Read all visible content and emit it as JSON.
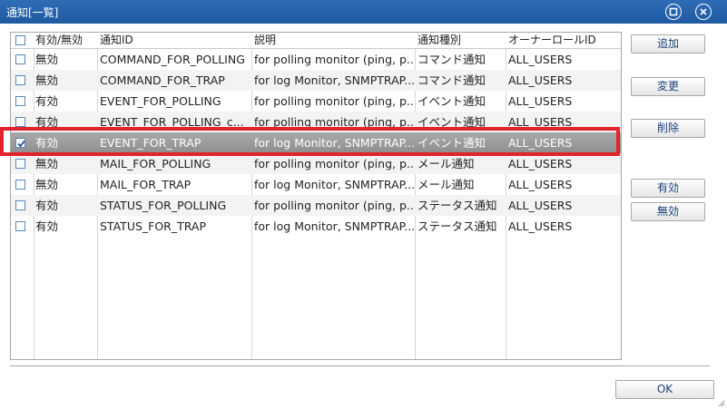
{
  "window": {
    "title": "通知[一覧]"
  },
  "table": {
    "headers": {
      "enabled": "有効/無効",
      "id": "通知ID",
      "desc": "説明",
      "type": "通知種別",
      "owner": "オーナーロールID"
    },
    "rows": [
      {
        "checked": false,
        "enabled": "無効",
        "id": "COMMAND_FOR_POLLING",
        "desc": "for polling monitor (ping, p...",
        "type": "コマンド通知",
        "owner": "ALL_USERS"
      },
      {
        "checked": false,
        "enabled": "無効",
        "id": "COMMAND_FOR_TRAP",
        "desc": "for log Monitor, SNMPTRAP...",
        "type": "コマンド通知",
        "owner": "ALL_USERS"
      },
      {
        "checked": false,
        "enabled": "有効",
        "id": "EVENT_FOR_POLLING",
        "desc": "for polling monitor (ping, p...",
        "type": "イベント通知",
        "owner": "ALL_USERS"
      },
      {
        "checked": false,
        "enabled": "有効",
        "id": "EVENT_FOR_POLLING_c...",
        "desc": "for polling monitor (ping, p...",
        "type": "イベント通知",
        "owner": "ALL_USERS"
      },
      {
        "checked": true,
        "enabled": "有効",
        "id": "EVENT_FOR_TRAP",
        "desc": "for log Monitor, SNMPTRAP...",
        "type": "イベント通知",
        "owner": "ALL_USERS"
      },
      {
        "checked": false,
        "enabled": "無効",
        "id": "MAIL_FOR_POLLING",
        "desc": "for polling monitor (ping, p...",
        "type": "メール通知",
        "owner": "ALL_USERS"
      },
      {
        "checked": false,
        "enabled": "無効",
        "id": "MAIL_FOR_TRAP",
        "desc": "for log Monitor, SNMPTRAP...",
        "type": "メール通知",
        "owner": "ALL_USERS"
      },
      {
        "checked": false,
        "enabled": "有効",
        "id": "STATUS_FOR_POLLING",
        "desc": "for polling monitor (ping, p...",
        "type": "ステータス通知",
        "owner": "ALL_USERS"
      },
      {
        "checked": false,
        "enabled": "有効",
        "id": "STATUS_FOR_TRAP",
        "desc": "for log Monitor, SNMPTRAP...",
        "type": "ステータス通知",
        "owner": "ALL_USERS"
      }
    ]
  },
  "buttons": {
    "add": "追加",
    "modify": "変更",
    "delete": "削除",
    "enable": "有効",
    "disable": "無効",
    "ok": "OK"
  },
  "colors": {
    "titlebar": "#2f6cb4",
    "highlight": "#e3222b",
    "selected_row": "#9a9a9a"
  },
  "icons": {
    "maximize": "maximize-icon",
    "close": "close-icon",
    "check": "checkmark-icon",
    "resize": "resize-grip-icon"
  }
}
